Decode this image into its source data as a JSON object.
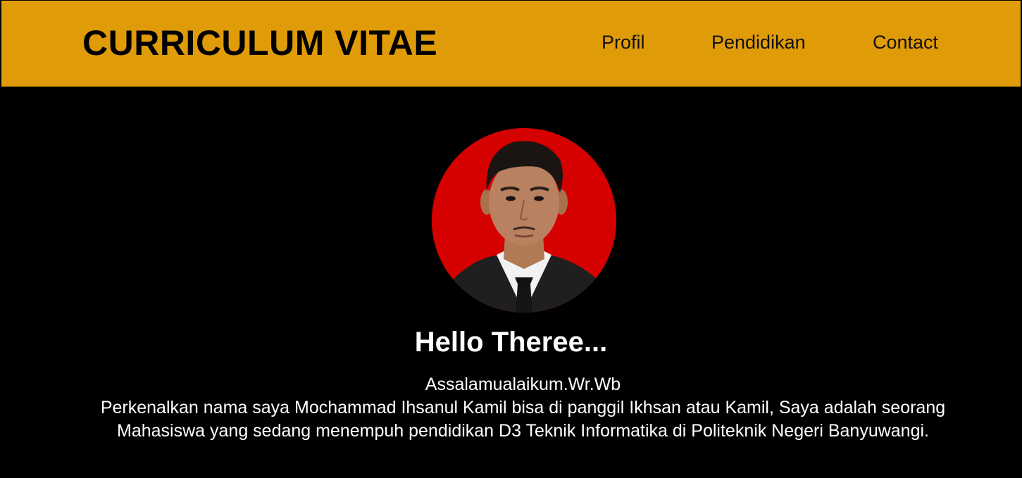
{
  "header": {
    "title": "CURRICULUM VITAE",
    "nav": [
      {
        "label": "Profil"
      },
      {
        "label": "Pendidikan"
      },
      {
        "label": "Contact"
      }
    ]
  },
  "profile": {
    "photo_alt": "profile-photo",
    "greeting": "Hello Theree...",
    "salutation": "Assalamualaikum.Wr.Wb",
    "intro": "Perkenalkan nama saya Mochammad Ihsanul Kamil bisa di panggil Ikhsan atau Kamil, Saya adalah seorang Mahasiswa yang sedang menempuh pendidikan D3 Teknik Informatika di Politeknik Negeri Banyuwangi."
  },
  "colors": {
    "header_bg": "#E09B08",
    "page_bg": "#000000",
    "photo_bg": "#D50000"
  }
}
